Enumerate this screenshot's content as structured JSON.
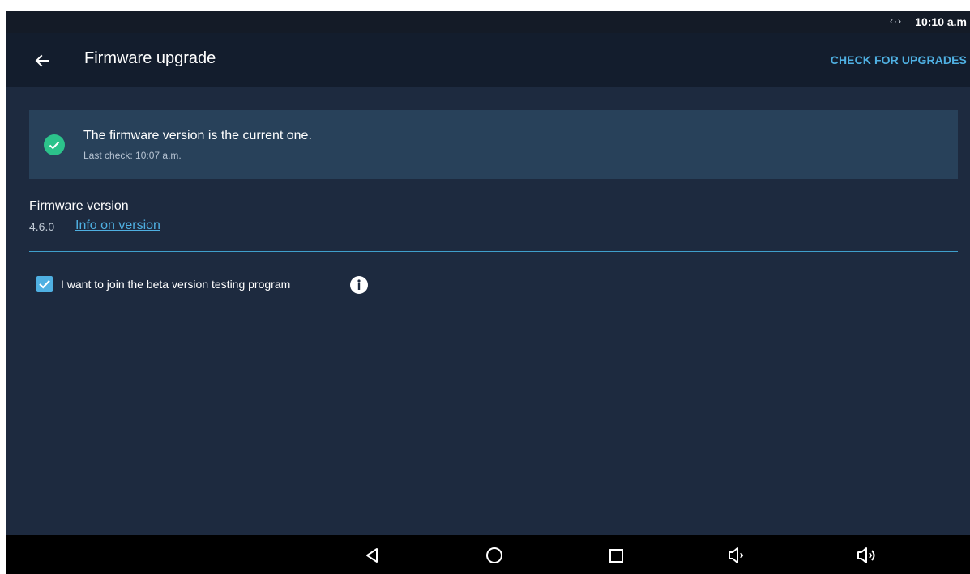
{
  "status_bar": {
    "sync_symbol": "‹·›",
    "time": "10:10 a.m"
  },
  "app_bar": {
    "title": "Firmware upgrade",
    "action_label": "CHECK FOR UPGRADES"
  },
  "status_card": {
    "message": "The firmware version is the current one.",
    "last_check": "Last check: 10:07 a.m."
  },
  "firmware": {
    "label": "Firmware version",
    "version": "4.6.0",
    "info_link": "Info on version"
  },
  "beta": {
    "label": "I want to join the beta version testing program",
    "checked": true
  },
  "nav_bar": {
    "buttons": [
      "back",
      "home",
      "recents",
      "volume-down",
      "volume-up"
    ]
  },
  "colors": {
    "background": "#1d2a3f",
    "app_bar": "#131d2d",
    "accent": "#4fb0e2",
    "success": "#2cc28b",
    "card": "#28415a"
  }
}
